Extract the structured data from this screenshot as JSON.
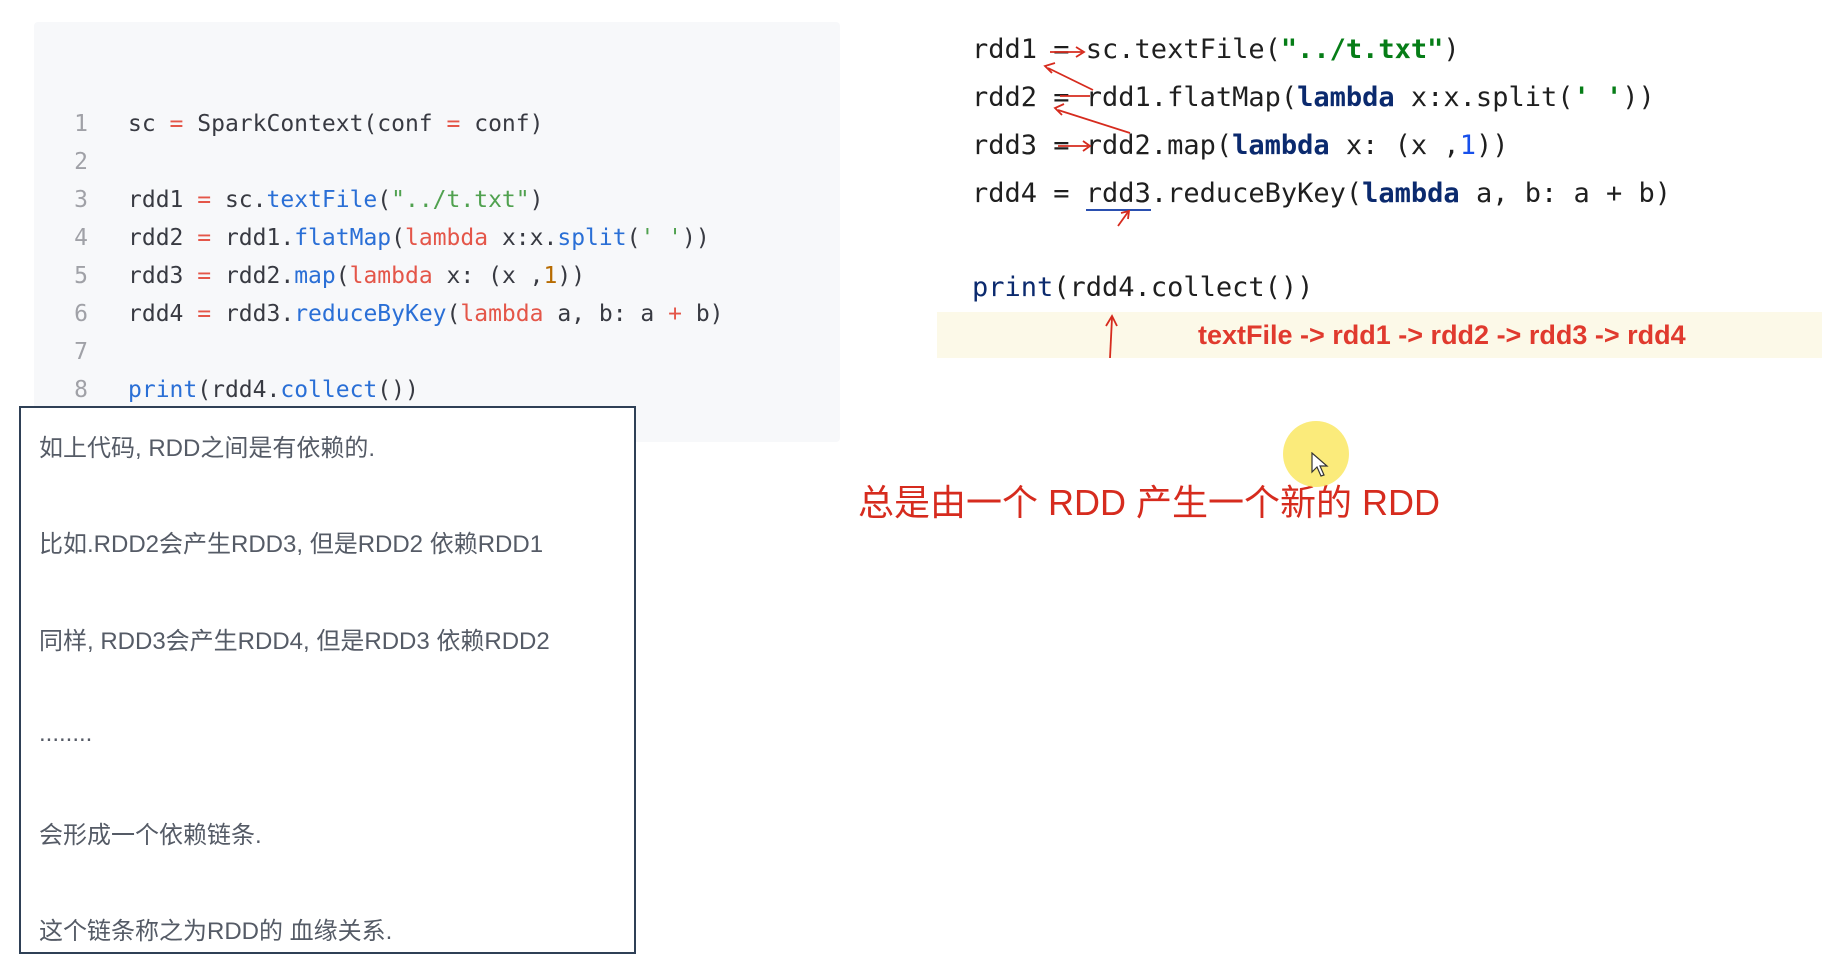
{
  "left_code": {
    "lines": [
      {
        "num": "1",
        "parts": [
          [
            "t",
            "sc "
          ],
          [
            "op",
            "="
          ],
          [
            "t",
            " SparkContext(conf "
          ],
          [
            "op",
            "="
          ],
          [
            "t",
            " conf)"
          ]
        ]
      },
      {
        "num": "2",
        "parts": []
      },
      {
        "num": "3",
        "parts": [
          [
            "t",
            "rdd1 "
          ],
          [
            "op",
            "="
          ],
          [
            "t",
            " sc."
          ],
          [
            "fn",
            "textFile"
          ],
          [
            "t",
            "("
          ],
          [
            "str",
            "\"../t.txt\""
          ],
          [
            "t",
            ")"
          ]
        ]
      },
      {
        "num": "4",
        "parts": [
          [
            "t",
            "rdd2 "
          ],
          [
            "op",
            "="
          ],
          [
            "t",
            " rdd1."
          ],
          [
            "fn",
            "flatMap"
          ],
          [
            "t",
            "("
          ],
          [
            "kw",
            "lambda"
          ],
          [
            "t",
            " x:x."
          ],
          [
            "fn",
            "split"
          ],
          [
            "t",
            "("
          ],
          [
            "str",
            "' '"
          ],
          [
            "t",
            "))"
          ]
        ]
      },
      {
        "num": "5",
        "parts": [
          [
            "t",
            "rdd3 "
          ],
          [
            "op",
            "="
          ],
          [
            "t",
            " rdd2."
          ],
          [
            "fn",
            "map"
          ],
          [
            "t",
            "("
          ],
          [
            "kw",
            "lambda"
          ],
          [
            "t",
            " x: (x ,"
          ],
          [
            "num",
            "1"
          ],
          [
            "t",
            "))"
          ]
        ]
      },
      {
        "num": "6",
        "parts": [
          [
            "t",
            "rdd4 "
          ],
          [
            "op",
            "="
          ],
          [
            "t",
            " rdd3."
          ],
          [
            "fn",
            "reduceByKey"
          ],
          [
            "t",
            "("
          ],
          [
            "kw",
            "lambda"
          ],
          [
            "t",
            " a, b: a "
          ],
          [
            "op",
            "+"
          ],
          [
            "t",
            " b)"
          ]
        ]
      },
      {
        "num": "7",
        "parts": []
      },
      {
        "num": "8",
        "parts": [
          [
            "fn",
            "print"
          ],
          [
            "t",
            "(rdd4."
          ],
          [
            "fn",
            "collect"
          ],
          [
            "t",
            "())"
          ]
        ]
      }
    ]
  },
  "notes": {
    "line1": "如上代码, RDD之间是有依赖的.",
    "line2": "比如.RDD2会产生RDD3, 但是RDD2 依赖RDD1",
    "line3": "同样, RDD3会产生RDD4, 但是RDD3 依赖RDD2",
    "line4": "........",
    "line5": "会形成一个依赖链条.",
    "line6": "这个链条称之为RDD的 血缘关系."
  },
  "right_code": {
    "l1_a": "rdd1 = sc.textFile(",
    "l1_str": "\"../t.txt\"",
    "l1_b": ")",
    "l2_a": "rdd2 = rdd1.flatMap(",
    "l2_kw": "lambda",
    "l2_b": " x:x.split(",
    "l2_str": "' '",
    "l2_c": "))",
    "l3_a": "rdd3 = rdd2.map(",
    "l3_kw": "lambda",
    "l3_b": " x: (x ,",
    "l3_num": "1",
    "l3_c": "))",
    "l4_a": "rdd4 = ",
    "l4_u": "rdd3",
    "l4_b": ".reduceByKey(",
    "l4_kw": "lambda",
    "l4_c": " a, b: a + b)",
    "l5_fn": "print",
    "l5_b": "(rdd4.collect())"
  },
  "chain": "textFile -> rdd1 -> rdd2 -> rdd3 -> rdd4",
  "summary": "总是由一个 RDD 产生一个新的 RDD",
  "colors": {
    "annotation_red": "#d62b1e",
    "note_border": "#2f4056",
    "highlight_band": "#fcf9e8"
  }
}
